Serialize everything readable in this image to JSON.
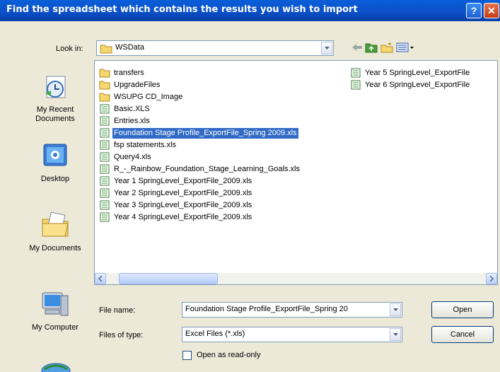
{
  "dialog": {
    "title": "Find the spreadsheet which contains the results you wish to import"
  },
  "toolbar": {
    "look_in_label": "Look in:",
    "look_in_value": "WSData"
  },
  "places_bar": [
    {
      "label": "My Recent Documents",
      "icon": "recent-documents-icon"
    },
    {
      "label": "Desktop",
      "icon": "desktop-icon"
    },
    {
      "label": "My Documents",
      "icon": "my-documents-icon"
    },
    {
      "label": "My Computer",
      "icon": "my-computer-icon"
    }
  ],
  "files": [
    {
      "name": "transfers",
      "type": "folder"
    },
    {
      "name": "UpgradeFiles",
      "type": "folder"
    },
    {
      "name": "WSUPG CD_Image",
      "type": "folder"
    },
    {
      "name": "Basic.XLS",
      "type": "xls"
    },
    {
      "name": "Entries.xls",
      "type": "xls"
    },
    {
      "name": "Foundation Stage Profile_ExportFile_Spring 2009.xls",
      "type": "xls",
      "selected": true
    },
    {
      "name": "fsp statements.xls",
      "type": "xls"
    },
    {
      "name": "Query4.xls",
      "type": "xls"
    },
    {
      "name": "R_-_Rainbow_Foundation_Stage_Learning_Goals.xls",
      "type": "xls"
    },
    {
      "name": "Year 1 SpringLevel_ExportFile_2009.xls",
      "type": "xls"
    },
    {
      "name": "Year 2 SpringLevel_ExportFile_2009.xls",
      "type": "xls"
    },
    {
      "name": "Year 3 SpringLevel_ExportFile_2009.xls",
      "type": "xls"
    },
    {
      "name": "Year 4 SpringLevel_ExportFile_2009.xls",
      "type": "xls"
    },
    {
      "name": "Year 5 SpringLevel_ExportFile",
      "type": "xls"
    },
    {
      "name": "Year 6 SpringLevel_ExportFile",
      "type": "xls"
    }
  ],
  "footer": {
    "file_name_label": "File name:",
    "file_name_value": "Foundation Stage Profile_ExportFile_Spring 20",
    "files_of_type_label": "Files of type:",
    "files_of_type_value": "Excel Files (*.xls)",
    "read_only_label": "Open as read-only",
    "read_only_checked": false,
    "open_label": "Open",
    "cancel_label": "Cancel"
  },
  "colors": {
    "titlebar": "#0a5fd8",
    "selection": "#316ac5",
    "dialog_bg": "#ece9d8"
  }
}
